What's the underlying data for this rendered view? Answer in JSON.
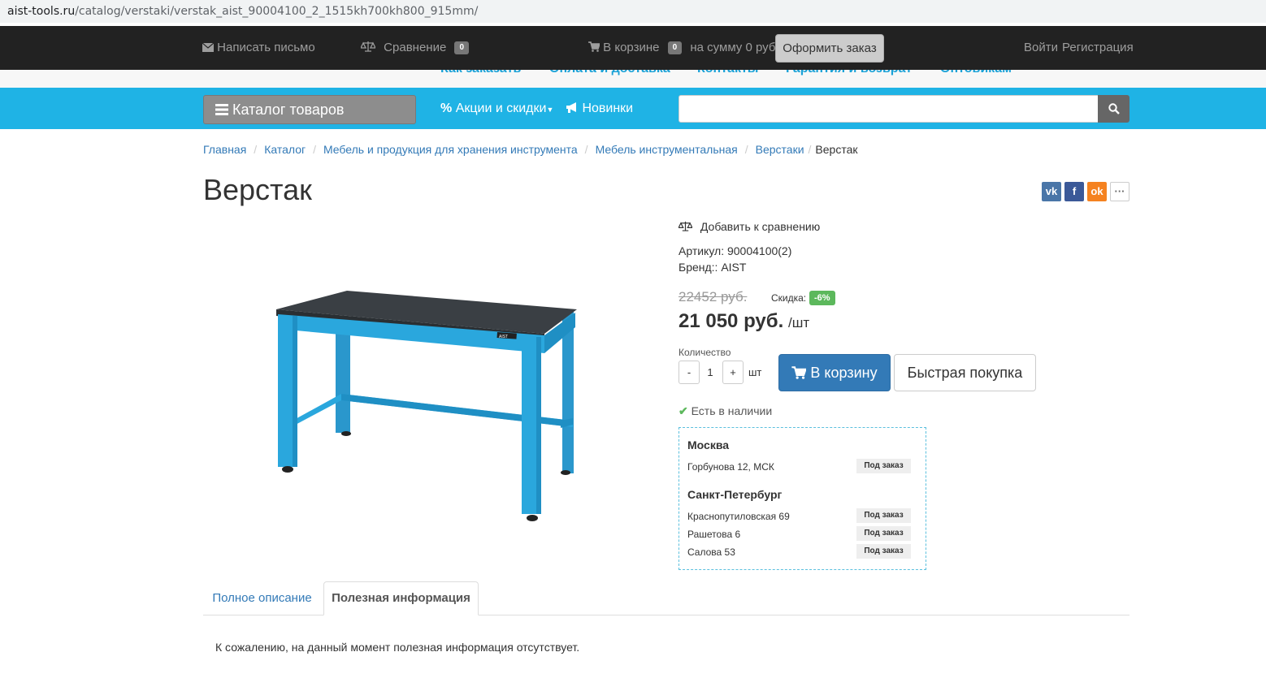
{
  "browser": {
    "url_host": "aist-tools.ru",
    "url_path": "/catalog/verstaki/verstak_aist_90004100_2_1515kh700kh800_915mm/"
  },
  "topbar": {
    "write_letter": "Написать письмо",
    "compare_label": "Сравнение",
    "compare_count": "0",
    "cart_label": "В корзине",
    "cart_count": "0",
    "cart_sum": "на сумму 0 руб.",
    "checkout": "Оформить заказ",
    "login": "Войти",
    "register": "Регистрация"
  },
  "subnav": [
    "Как заказать",
    "Оплата и доставка",
    "Контакты",
    "Гарантия и возврат",
    "Оптовикам"
  ],
  "mainnav": {
    "catalog": "Каталог товаров",
    "promo": "Акции и скидки",
    "new": "Новинки",
    "search_placeholder": ""
  },
  "breadcrumb": [
    "Главная",
    "Каталог",
    "Мебель и продукция для хранения инструмента",
    "Мебель инструментальная",
    "Верстаки",
    "Верстак"
  ],
  "product": {
    "title": "Верстак",
    "compare_link": "Добавить к сравнению",
    "article": "Артикул: 90004100(2)",
    "brand": "Бренд:: AIST",
    "old_price": "22452 руб.",
    "discount_label": "Скидка:",
    "discount": "-6%",
    "price": "21 050 руб.",
    "unit": "/шт",
    "qty_label": "Количество",
    "qty_minus": "-",
    "qty_value": "1",
    "qty_plus": "+",
    "qty_unit": "шт",
    "add_to_cart": "В корзину",
    "quick_buy": "Быстрая покупка",
    "in_stock": "Есть в наличии",
    "image_logo": "AIST"
  },
  "stores": [
    {
      "city": "Москва",
      "shops": [
        {
          "address": "Горбунова 12, МСК",
          "status": "Под заказ"
        }
      ]
    },
    {
      "city": "Санкт-Петербург",
      "shops": [
        {
          "address": "Краснопутиловская 69",
          "status": "Под заказ"
        },
        {
          "address": "Рашетова 6",
          "status": "Под заказ"
        },
        {
          "address": "Салова 53",
          "status": "Под заказ"
        }
      ]
    }
  ],
  "tabs": {
    "full_description": "Полное описание",
    "useful_info": "Полезная информация",
    "useful_info_text": "К сожалению, на данный момент полезная информация отсутствует."
  },
  "social": {
    "vk": "vk",
    "fb": "f",
    "ok": "ok",
    "more": "···"
  },
  "colors": {
    "cyan": "#1fb3e5",
    "primary": "#337ab7",
    "dark": "#222222",
    "success": "#5cb85c",
    "table_blue": "#2aa7dd"
  }
}
